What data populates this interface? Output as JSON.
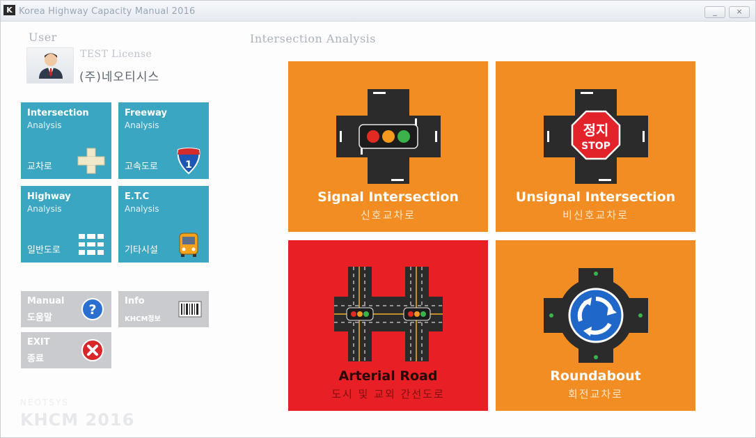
{
  "window": {
    "title": "Korea Highway Capacity Manual 2016",
    "logo": "K",
    "minimize_label": "_",
    "close_label": "×"
  },
  "user": {
    "section_label": "User",
    "license": "TEST License",
    "company": "(주)네오티시스",
    "avatar_icon": "user-avatar-icon"
  },
  "analysis_tiles": [
    {
      "title": "Intersection",
      "subtitle": "Analysis",
      "korean": "교차로",
      "icon": "intersection-icon"
    },
    {
      "title": "Freeway",
      "subtitle": "Analysis",
      "korean": "고속도로",
      "icon": "interstate-shield-icon"
    },
    {
      "title": "Highway",
      "subtitle": "Analysis",
      "korean": "일반도로",
      "icon": "road-lanes-icon"
    },
    {
      "title": "E.T.C",
      "subtitle": "Analysis",
      "korean": "기타시설",
      "icon": "bus-icon"
    }
  ],
  "utility_buttons": {
    "manual": {
      "title": "Manual",
      "korean": "도움말",
      "icon": "help-icon"
    },
    "info": {
      "title": "Info",
      "korean": "KHCM정보",
      "icon": "barcode-icon"
    },
    "exit": {
      "title": "EXIT",
      "korean": "종료",
      "icon": "close-icon"
    }
  },
  "brand": {
    "company": "NEOTSYS",
    "product": "KHCM 2016"
  },
  "main": {
    "section_label": "Intersection Analysis",
    "cards": [
      {
        "title": "Signal Intersection",
        "korean": "신호교차로",
        "icon": "traffic-signal-icon",
        "color": "#f28d23"
      },
      {
        "title": "Unsignal Intersection",
        "korean": "비신호교차로",
        "icon": "stop-sign-icon",
        "stop_kr": "정지",
        "stop_en": "STOP",
        "color": "#f28d23"
      },
      {
        "title": "Arterial Road",
        "korean": "도시 및 교외 간선도로",
        "icon": "arterial-road-icon",
        "color": "#e81f24"
      },
      {
        "title": "Roundabout",
        "korean": "회전교차로",
        "icon": "roundabout-icon",
        "color": "#f28d23"
      }
    ]
  },
  "colors": {
    "tile_blue": "#3aa6c1",
    "card_orange": "#f28d23",
    "card_red": "#e81f24",
    "button_gray": "#c9cbcf"
  }
}
